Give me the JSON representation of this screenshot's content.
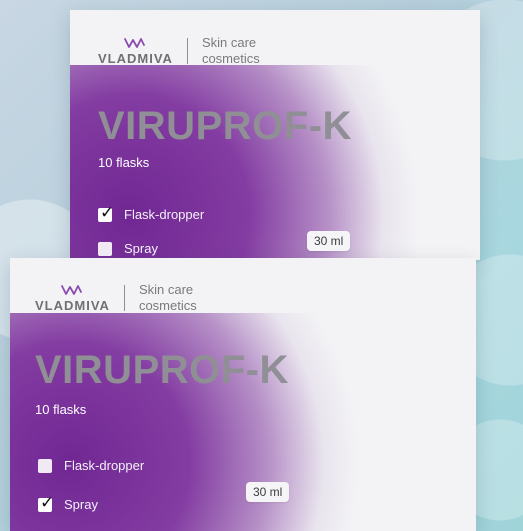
{
  "packages": [
    {
      "brand_name": "VLADMIVA",
      "tagline_line1": "Skin care",
      "tagline_line2": "cosmetics",
      "product_name": "VIRUPROF-K",
      "flask_count": "10 flasks",
      "options": [
        {
          "label": "Flask-dropper",
          "checked": true
        },
        {
          "label": "Spray",
          "checked": false
        }
      ],
      "volume": "30 ml"
    },
    {
      "brand_name": "VLADMIVA",
      "tagline_line1": "Skin care",
      "tagline_line2": "cosmetics",
      "product_name": "VIRUPROF-K",
      "flask_count": "10 flasks",
      "options": [
        {
          "label": "Flask-dropper",
          "checked": false
        },
        {
          "label": "Spray",
          "checked": true
        }
      ],
      "volume": "30 ml"
    }
  ],
  "colors": {
    "card_background": "#f3f3f5",
    "purple_accent": "#7a2d9b",
    "title_gray": "#8f8f95",
    "text_gray": "#707074",
    "background_blue": "#b7cfdc"
  },
  "icons": {
    "logo": "vladmiva-logo-icon",
    "checkbox_checked": "checkmark-icon",
    "checkbox_unchecked": "empty-checkbox-icon"
  }
}
